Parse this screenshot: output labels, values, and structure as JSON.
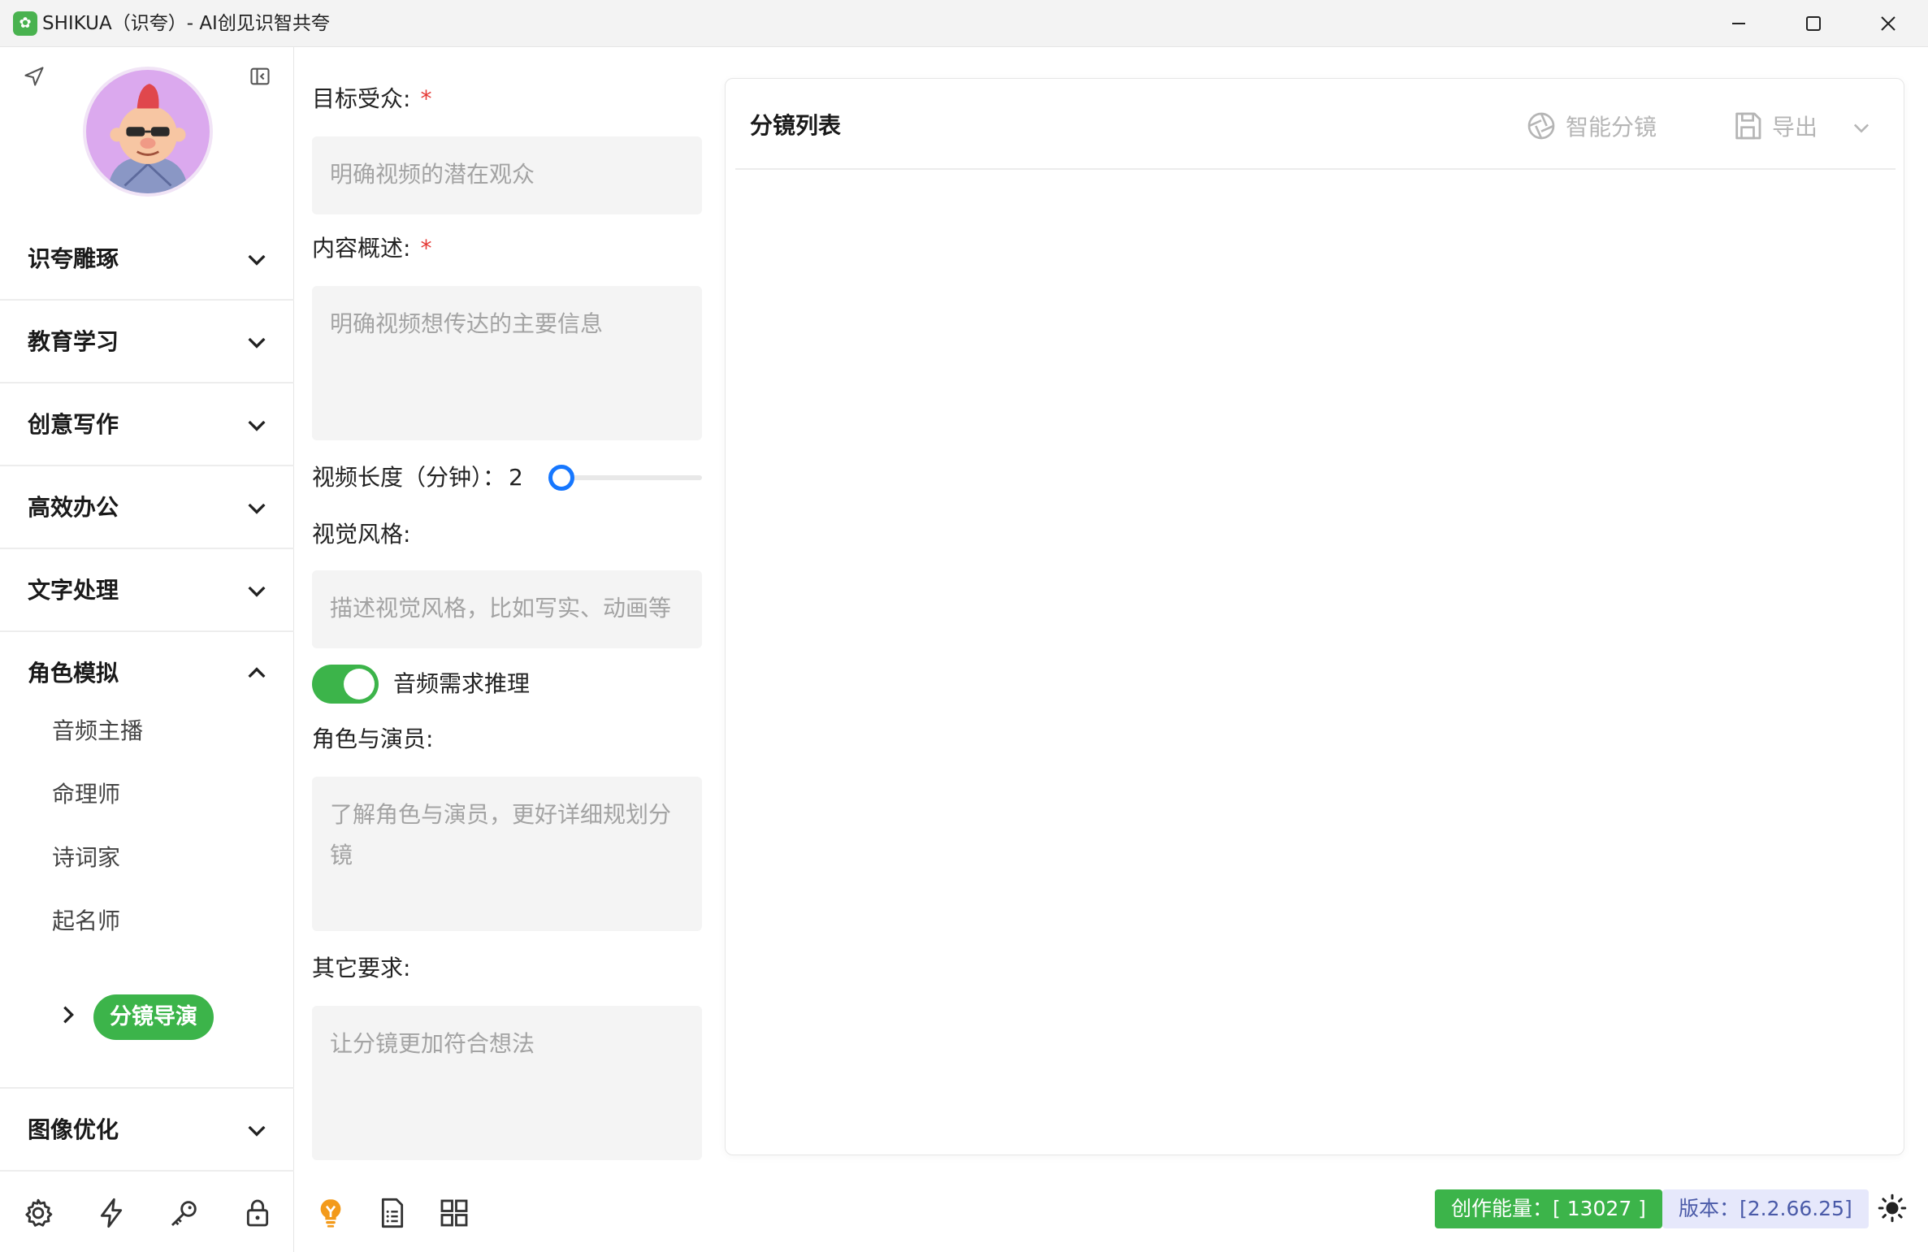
{
  "window": {
    "title": "SHIKUA（识夸）- AI创见识智共夸",
    "logo_icon": "app-logo-icon",
    "accent": "#3cb44a"
  },
  "sidebar": {
    "categories": [
      {
        "label": "识夸雕琢",
        "expanded": false
      },
      {
        "label": "教育学习",
        "expanded": false
      },
      {
        "label": "创意写作",
        "expanded": false
      },
      {
        "label": "高效办公",
        "expanded": false
      },
      {
        "label": "文字处理",
        "expanded": false
      },
      {
        "label": "角色模拟",
        "expanded": true
      }
    ],
    "sub_items": [
      "音频主播",
      "命理师",
      "诗词家",
      "起名师"
    ],
    "active_item": "分镜导演",
    "after_category": {
      "label": "图像优化",
      "expanded": false
    }
  },
  "form": {
    "audience": {
      "label": "目标受众:",
      "required_mark": "*",
      "placeholder": "明确视频的潜在观众"
    },
    "summary": {
      "label": "内容概述:",
      "required_mark": "*",
      "placeholder": "明确视频想传达的主要信息"
    },
    "length": {
      "label": "视频长度（分钟）：",
      "value": "2",
      "min": 1,
      "max": 10
    },
    "style": {
      "label": "视觉风格:",
      "placeholder": "描述视觉风格，比如写实、动画等"
    },
    "audio_toggle": {
      "label": "音频需求推理",
      "on": true
    },
    "roles": {
      "label": "角色与演员:",
      "placeholder": "了解角色与演员，更好详细规划分镜"
    },
    "other": {
      "label": "其它要求:",
      "placeholder": "让分镜更加符合想法"
    }
  },
  "panel": {
    "title": "分镜列表",
    "smart_label": "智能分镜",
    "export_label": "导出"
  },
  "status": {
    "energy": "创作能量：[ 13027 ]",
    "version": "版本：[2.2.66.25]"
  }
}
